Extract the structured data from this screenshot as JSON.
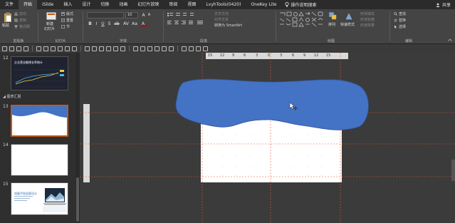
{
  "menubar": {
    "tabs": [
      "文件",
      "开始",
      "iSlide",
      "插入",
      "设计",
      "切换",
      "动画",
      "幻灯片放映",
      "审阅",
      "视图",
      "LvyhTools(0420)",
      "OneKey Lite"
    ],
    "active_index": 1,
    "tell_me": "操作说明搜索",
    "share": "共享"
  },
  "ribbon": {
    "clipboard": {
      "paste": "粘贴",
      "cut": "剪切",
      "copy": "复制",
      "format_painter": "格式刷",
      "label": "剪贴板"
    },
    "slides": {
      "new_slide": "新建",
      "new_slide2": "幻灯片",
      "layout": "版式",
      "reset": "重置",
      "section": "节",
      "label": "幻灯片"
    },
    "font": {
      "size": "10",
      "label": "字体",
      "buttons": [
        "B",
        "I",
        "U",
        "S",
        "ab",
        "AV",
        "Aa",
        "A",
        "A"
      ]
    },
    "paragraph": {
      "text_direction": "文字方向",
      "align_text": "对齐文本",
      "smartart": "转换为 SmartArt",
      "label": "段落"
    },
    "drawing": {
      "arrange": "排列",
      "quick_styles": "快速样式",
      "fill": "形状填充",
      "outline": "形状轮廓",
      "effects": "形状效果",
      "label": "绘图"
    },
    "editing": {
      "find": "查找",
      "replace": "替换",
      "select": "选择",
      "label": "编辑"
    }
  },
  "sidepanel": {
    "slides": [
      {
        "num": "12",
        "title": "企业营业额增长率统计"
      },
      {
        "num": "13"
      },
      {
        "num": "14"
      },
      {
        "num": "15",
        "title": "电脑手绘创意设计"
      }
    ],
    "section": "图表汇报"
  },
  "ruler": {
    "ticks": [
      "15",
      "12",
      "9",
      "6",
      "3",
      "0",
      "3",
      "6",
      "9",
      "12",
      "15"
    ]
  },
  "colors": {
    "accent": "#c55a11",
    "wave": "#4472c4",
    "wave_stroke": "#2f528f",
    "guide": "#e05a3a"
  }
}
